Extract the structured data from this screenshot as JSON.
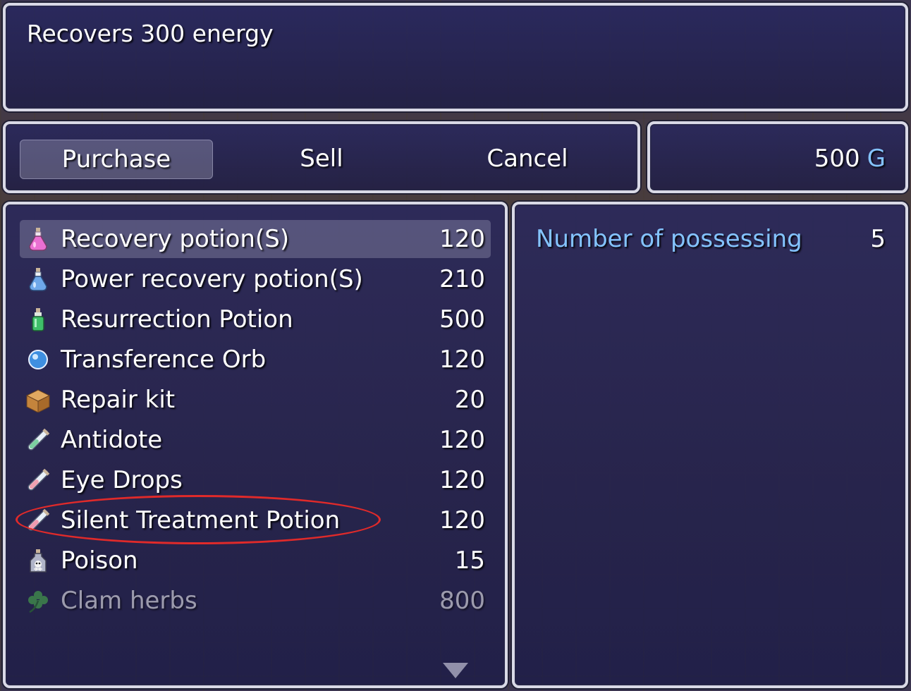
{
  "help": {
    "description": "Recovers 300 energy"
  },
  "commands": [
    {
      "label": "Purchase",
      "selected": true
    },
    {
      "label": "Sell",
      "selected": false
    },
    {
      "label": "Cancel",
      "selected": false
    }
  ],
  "gold": {
    "amount": "500",
    "unit": "G"
  },
  "items": [
    {
      "name": "Recovery potion(S)",
      "price": "120",
      "icon": "pink-potion-icon",
      "selected": true,
      "enabled": true
    },
    {
      "name": "Power recovery potion(S)",
      "price": "210",
      "icon": "blue-potion-icon",
      "selected": false,
      "enabled": true
    },
    {
      "name": "Resurrection Potion",
      "price": "500",
      "icon": "green-potion-icon",
      "selected": false,
      "enabled": true
    },
    {
      "name": "Transference Orb",
      "price": "120",
      "icon": "blue-orb-icon",
      "selected": false,
      "enabled": true
    },
    {
      "name": "Repair kit",
      "price": "20",
      "icon": "crate-icon",
      "selected": false,
      "enabled": true
    },
    {
      "name": "Antidote",
      "price": "120",
      "icon": "test-tube-icon",
      "selected": false,
      "enabled": true
    },
    {
      "name": "Eye Drops",
      "price": "120",
      "icon": "test-tube-icon",
      "selected": false,
      "enabled": true
    },
    {
      "name": "Silent Treatment Potion",
      "price": "120",
      "icon": "test-tube-icon",
      "selected": false,
      "enabled": true
    },
    {
      "name": "Poison",
      "price": "15",
      "icon": "skull-bottle-icon",
      "selected": false,
      "enabled": true
    },
    {
      "name": "Clam herbs",
      "price": "800",
      "icon": "clover-icon",
      "selected": false,
      "enabled": false
    }
  ],
  "status": {
    "possess_label": "Number of possessing",
    "possess_count": "5"
  },
  "colors": {
    "system_blue": "#84c3ff",
    "annotation_red": "#e02a2a"
  }
}
